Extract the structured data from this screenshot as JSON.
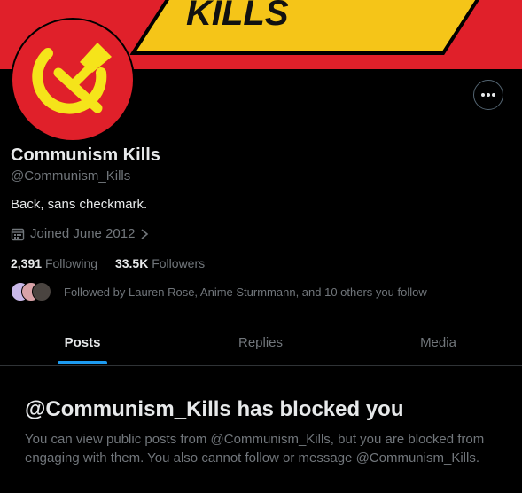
{
  "banner": {
    "text": "KILLS",
    "bg_color": "#e0202a",
    "accent_color": "#f5c518"
  },
  "avatar": {
    "bg_color": "#e0202a",
    "symbol_color": "#f5e41a"
  },
  "profile": {
    "display_name": "Communism Kills",
    "handle": "@Communism_Kills",
    "bio": "Back, sans checkmark.",
    "joined": "Joined June 2012",
    "following_count": "2,391",
    "following_label": "Following",
    "followers_count": "33.5K",
    "followers_label": "Followers",
    "followed_by": "Followed by Lauren Rose, Anime Sturmmann, and 10 others you follow"
  },
  "tabs": [
    {
      "label": "Posts",
      "active": true
    },
    {
      "label": "Replies",
      "active": false
    },
    {
      "label": "Media",
      "active": false
    }
  ],
  "blocked": {
    "title": "@Communism_Kills has blocked you",
    "message": "You can view public posts from @Communism_Kills, but you are blocked from engaging with them. You also cannot follow or message @Communism_Kills."
  },
  "icons": {
    "more": "more-dots-icon",
    "calendar": "calendar-icon",
    "chevron": "chevron-right-icon"
  },
  "colors": {
    "accent": "#1d9bf0",
    "muted": "#71767b",
    "text": "#e7e9ea",
    "border": "#2f3336"
  }
}
